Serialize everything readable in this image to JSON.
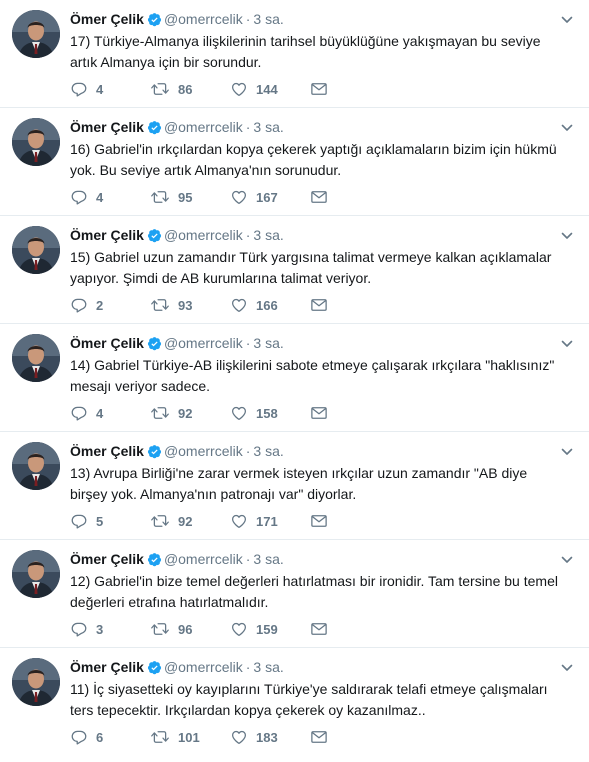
{
  "author": {
    "name": "Ömer Çelik",
    "handle": "@omerrcelik",
    "separator": "·",
    "time": "3 sa."
  },
  "tweets": [
    {
      "text": "17) Türkiye-Almanya ilişkilerinin tarihsel büyüklüğüne yakışmayan bu seviye artık Almanya için bir sorundur.",
      "replies": "4",
      "retweets": "86",
      "likes": "144"
    },
    {
      "text": "16) Gabriel'in ırkçılardan kopya çekerek yaptığı açıklamaların bizim için hükmü yok. Bu seviye artık Almanya'nın sorunudur.",
      "replies": "4",
      "retweets": "95",
      "likes": "167"
    },
    {
      "text": "15) Gabriel uzun zamandır Türk yargısına talimat vermeye kalkan açıklamalar yapıyor. Şimdi de AB kurumlarına talimat veriyor.",
      "replies": "2",
      "retweets": "93",
      "likes": "166"
    },
    {
      "text": "14) Gabriel Türkiye-AB ilişkilerini sabote etmeye çalışarak ırkçılara \"haklısınız\" mesajı veriyor sadece.",
      "replies": "4",
      "retweets": "92",
      "likes": "158"
    },
    {
      "text": "13) Avrupa Birliği'ne zarar vermek isteyen ırkçılar uzun zamandır \"AB diye birşey yok. Almanya'nın patronajı var\" diyorlar.",
      "replies": "5",
      "retweets": "92",
      "likes": "171"
    },
    {
      "text": "12) Gabriel'in bize temel değerleri hatırlatması bir ironidir. Tam tersine bu temel değerleri etrafına hatırlatmalıdır.",
      "replies": "3",
      "retweets": "96",
      "likes": "159"
    },
    {
      "text": "11) İç siyasetteki oy kayıplarını Türkiye'ye saldırarak telafi etmeye çalışmaları ters tepecektir. Irkçılardan kopya çekerek oy kazanılmaz..",
      "replies": "6",
      "retweets": "101",
      "likes": "183"
    }
  ],
  "icons": {
    "verified": "verified-badge-icon",
    "caret": "chevron-down-icon",
    "reply": "reply-icon",
    "retweet": "retweet-icon",
    "like": "heart-icon",
    "dm": "envelope-icon"
  },
  "colors": {
    "verified": "#1da1f2",
    "text": "#14171a",
    "secondary": "#657786",
    "divider": "#e6ecf0"
  }
}
